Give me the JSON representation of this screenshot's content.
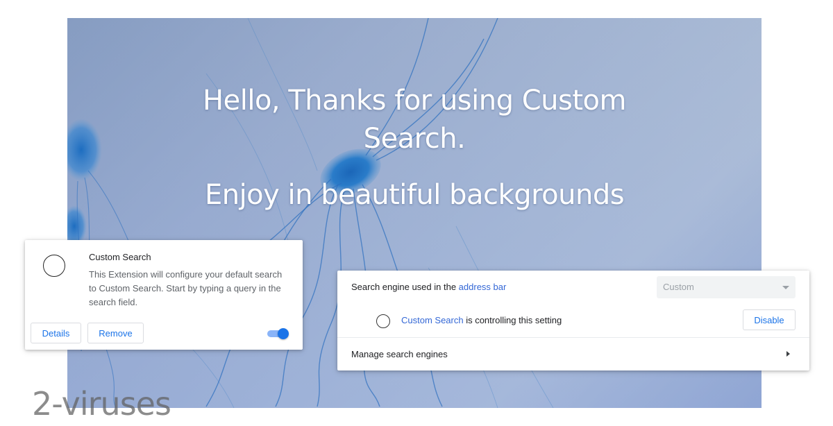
{
  "hero": {
    "title_line1": "Hello, Thanks for using Custom",
    "title_line2": "Search.",
    "subtitle": "Enjoy in beautiful backgrounds"
  },
  "extension_card": {
    "name": "Custom Search",
    "description": "This Extension will configure your default search to Custom Search. Start by typing a query in the search field.",
    "details_label": "Details",
    "remove_label": "Remove",
    "toggle_on": true,
    "accent_color": "#1a73e8"
  },
  "settings_card": {
    "search_engine_label_prefix": "Search engine used in the ",
    "search_engine_label_link": "address bar",
    "search_engine_value": "Custom",
    "controller_link": "Custom Search",
    "controller_suffix": " is controlling this setting",
    "disable_label": "Disable",
    "manage_label": "Manage search engines",
    "link_color": "#3367d6"
  },
  "watermark": {
    "text": "2-viruses"
  }
}
